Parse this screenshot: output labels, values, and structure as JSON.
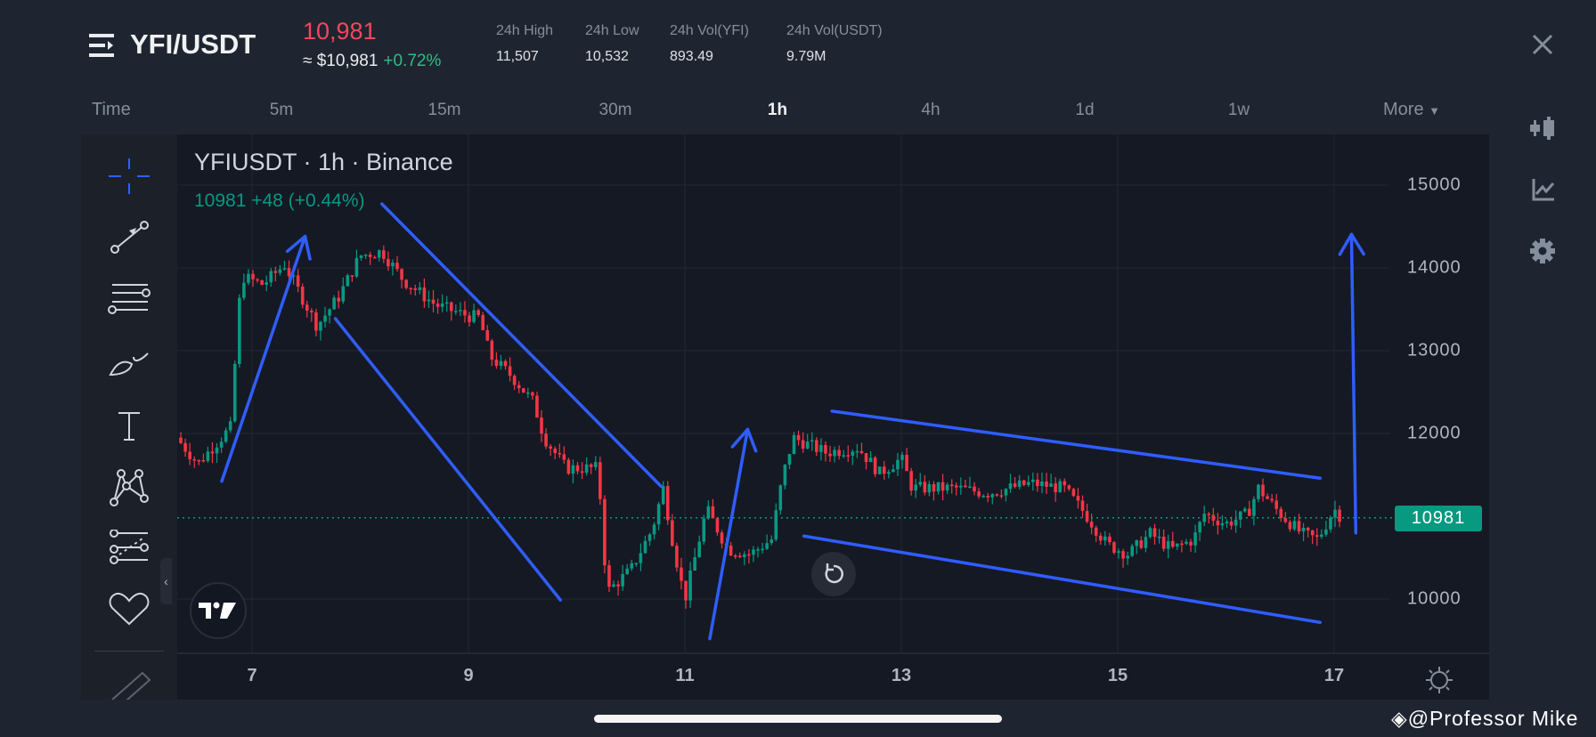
{
  "header": {
    "pair": "YFI/USDT",
    "last_price": "10,981",
    "approx_usd": "≈ $10,981",
    "change_pct": "+0.72%",
    "stats": [
      {
        "label": "24h High",
        "value": "11,507"
      },
      {
        "label": "24h Low",
        "value": "10,532"
      },
      {
        "label": "24h Vol(YFI)",
        "value": "893.49"
      },
      {
        "label": "24h Vol(USDT)",
        "value": "9.79M"
      }
    ]
  },
  "timeframes": {
    "label": "Time",
    "items": [
      "5m",
      "15m",
      "30m",
      "1h",
      "4h",
      "1d",
      "1w"
    ],
    "active": "1h",
    "more": "More"
  },
  "chart_header": {
    "title": "YFIUSDT · 1h · Binance",
    "ohlc": "10981  +48 (+0.44%)"
  },
  "price_tag": "10981",
  "watermark": "@Professor Mike",
  "colors": {
    "up": "#089981",
    "down": "#f23645",
    "drawing": "#2f5dff",
    "bg": "#151924"
  },
  "chart_data": {
    "type": "candlestick",
    "symbol": "YFIUSDT",
    "interval": "1h",
    "exchange": "Binance",
    "ylim": [
      9400,
      15600
    ],
    "y_ticks": [
      10000,
      12000,
      13000,
      14000,
      15000
    ],
    "y_tick_labels": [
      "10000",
      "12000",
      "13000",
      "14000",
      "15000"
    ],
    "x_ticks": [
      7,
      9,
      11,
      13,
      15,
      17
    ],
    "x_tick_labels": [
      "7",
      "9",
      "11",
      "13",
      "15",
      "17"
    ],
    "xlim_days": [
      6.35,
      17.6
    ],
    "last_price": 10981,
    "close_path_day_price": [
      [
        6.3,
        11950
      ],
      [
        6.5,
        11640
      ],
      [
        6.8,
        12070
      ],
      [
        6.9,
        13900
      ],
      [
        7.1,
        13800
      ],
      [
        7.3,
        14040
      ],
      [
        7.5,
        13550
      ],
      [
        7.6,
        13300
      ],
      [
        7.8,
        13650
      ],
      [
        8.0,
        14150
      ],
      [
        8.2,
        14200
      ],
      [
        8.4,
        13850
      ],
      [
        8.7,
        13550
      ],
      [
        9.0,
        13420
      ],
      [
        9.1,
        13400
      ],
      [
        9.2,
        12930
      ],
      [
        9.4,
        12690
      ],
      [
        9.6,
        12380
      ],
      [
        9.7,
        11950
      ],
      [
        9.9,
        11580
      ],
      [
        10.2,
        11580
      ],
      [
        10.25,
        10540
      ],
      [
        10.3,
        10110
      ],
      [
        10.5,
        10350
      ],
      [
        10.7,
        10850
      ],
      [
        10.8,
        11340
      ],
      [
        10.9,
        10600
      ],
      [
        11.0,
        9990
      ],
      [
        11.1,
        10540
      ],
      [
        11.2,
        11090
      ],
      [
        11.4,
        10600
      ],
      [
        11.6,
        10540
      ],
      [
        11.8,
        10720
      ],
      [
        11.9,
        11460
      ],
      [
        12.0,
        11950
      ],
      [
        12.3,
        11770
      ],
      [
        12.6,
        11830
      ],
      [
        12.8,
        11520
      ],
      [
        13.0,
        11700
      ],
      [
        13.1,
        11340
      ],
      [
        13.5,
        11340
      ],
      [
        13.8,
        11280
      ],
      [
        14.2,
        11400
      ],
      [
        14.5,
        11340
      ],
      [
        14.7,
        11030
      ],
      [
        14.9,
        10660
      ],
      [
        15.1,
        10540
      ],
      [
        15.3,
        10790
      ],
      [
        15.5,
        10600
      ],
      [
        15.7,
        10720
      ],
      [
        15.8,
        11030
      ],
      [
        16.0,
        10910
      ],
      [
        16.2,
        11030
      ],
      [
        16.3,
        11340
      ],
      [
        16.5,
        11030
      ],
      [
        16.7,
        10790
      ],
      [
        16.85,
        10720
      ],
      [
        17.0,
        11090
      ],
      [
        17.07,
        10981
      ]
    ],
    "drawings": [
      {
        "type": "arrow",
        "from": [
          6.72,
          11423
        ],
        "to": [
          7.49,
          14381
        ]
      },
      {
        "type": "line",
        "from": [
          7.77,
          13387
        ],
        "to": [
          9.85,
          9988
        ]
      },
      {
        "type": "line",
        "from": [
          8.2,
          14773
        ],
        "to": [
          10.78,
          11362
        ]
      },
      {
        "type": "arrow",
        "from": [
          11.23,
          9521
        ],
        "to": [
          11.58,
          12049
        ]
      },
      {
        "type": "line",
        "from": [
          12.36,
          12270
        ],
        "to": [
          16.87,
          11460
        ]
      },
      {
        "type": "line",
        "from": [
          12.1,
          10761
        ],
        "to": [
          16.87,
          9718
        ]
      },
      {
        "type": "arrow",
        "from": [
          17.2,
          10798
        ],
        "to": [
          17.16,
          14405
        ]
      }
    ]
  }
}
